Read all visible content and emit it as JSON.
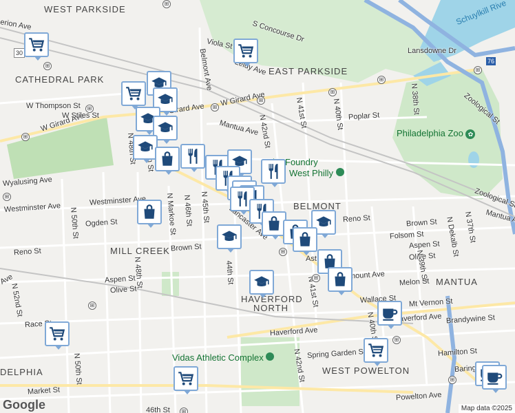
{
  "areas": [
    {
      "id": "west-parkside",
      "text": "WEST PARKSIDE"
    },
    {
      "id": "east-parkside",
      "text": "EAST PARKSIDE"
    },
    {
      "id": "cathedral-park",
      "text": "CATHEDRAL PARK"
    },
    {
      "id": "belmont",
      "text": "BELMONT"
    },
    {
      "id": "mill-creek",
      "text": "MILL CREEK"
    },
    {
      "id": "mantua",
      "text": "MANTUA"
    },
    {
      "id": "haverford-north-1",
      "text": "HAVERFORD"
    },
    {
      "id": "haverford-north-2",
      "text": "NORTH"
    },
    {
      "id": "west-powelton",
      "text": "WEST POWELTON"
    },
    {
      "id": "delphia",
      "text": "DELPHIA"
    }
  ],
  "pois": [
    {
      "id": "philadelphia-zoo",
      "text": "Philadelphia Zoo"
    },
    {
      "id": "foundry-1",
      "text": "The Foundry"
    },
    {
      "id": "foundry-2",
      "text": "West Philly"
    },
    {
      "id": "vidas",
      "text": "Vidas Athletic Complex"
    }
  ],
  "water": [
    {
      "id": "schuylkill",
      "text": "Schuylkill Rive"
    }
  ],
  "streets": [
    {
      "id": "s-concourse",
      "text": "S Concourse Dr"
    },
    {
      "id": "viola",
      "text": "Viola St"
    },
    {
      "id": "leidy",
      "text": "Leidy Ave"
    },
    {
      "id": "lansdowne",
      "text": "Lansdowne Dr"
    },
    {
      "id": "belmont-ave",
      "text": "Belmont Ave"
    },
    {
      "id": "w-girard-1",
      "text": "W Girard Ave"
    },
    {
      "id": "w-girard-2",
      "text": "W Girard Ave"
    },
    {
      "id": "girard-ave",
      "text": "Girard Ave"
    },
    {
      "id": "w-thompson",
      "text": "W Thompson St"
    },
    {
      "id": "w-stiles",
      "text": "W Stiles St"
    },
    {
      "id": "mantua-ave",
      "text": "Mantua Ave"
    },
    {
      "id": "mantua-ave-2",
      "text": "Mantua Ave"
    },
    {
      "id": "poplar",
      "text": "Poplar St"
    },
    {
      "id": "n-41st",
      "text": "N 41st St"
    },
    {
      "id": "n-40th",
      "text": "N 40th St"
    },
    {
      "id": "n-38th",
      "text": "N 38th St"
    },
    {
      "id": "n-42nd",
      "text": "N 42nd St"
    },
    {
      "id": "n-42nd-2",
      "text": "N 42nd St"
    },
    {
      "id": "zoological",
      "text": "Zoological St"
    },
    {
      "id": "zoological-2",
      "text": "Zoological St"
    },
    {
      "id": "wyalusing",
      "text": "Wyalusing Ave"
    },
    {
      "id": "westminster-1",
      "text": "Westminster Ave"
    },
    {
      "id": "westminster-2",
      "text": "Westminster Ave"
    },
    {
      "id": "n-48th",
      "text": "N 48th St"
    },
    {
      "id": "n-48th-2",
      "text": "N 48th St"
    },
    {
      "id": "n-47th",
      "text": "47th St"
    },
    {
      "id": "n-50th",
      "text": "N 50th St"
    },
    {
      "id": "ogden",
      "text": "Ogden St"
    },
    {
      "id": "n-markoe",
      "text": "N Markoe St"
    },
    {
      "id": "n-46th",
      "text": "N 46th St"
    },
    {
      "id": "n-45th",
      "text": "N 45th St"
    },
    {
      "id": "lancaster",
      "text": "Lancaster Ave"
    },
    {
      "id": "reno-w",
      "text": "Reno St"
    },
    {
      "id": "reno-e",
      "text": "Reno St"
    },
    {
      "id": "brown-w",
      "text": "Brown St"
    },
    {
      "id": "brown-e",
      "text": "Brown St"
    },
    {
      "id": "folsom",
      "text": "Folsom St"
    },
    {
      "id": "aspen-e",
      "text": "Aspen St"
    },
    {
      "id": "aspen-w",
      "text": "Aspen St"
    },
    {
      "id": "olive-e",
      "text": "Olive St"
    },
    {
      "id": "olive-w",
      "text": "Olive St"
    },
    {
      "id": "n-dekalb",
      "text": "N Dekalb St"
    },
    {
      "id": "n-37th",
      "text": "N 37th St"
    },
    {
      "id": "n-39th",
      "text": "N 39th St"
    },
    {
      "id": "n-44th",
      "text": "44th St"
    },
    {
      "id": "fairmount",
      "text": "mount Ave"
    },
    {
      "id": "melon",
      "text": "Melon St"
    },
    {
      "id": "n-41st-s",
      "text": "N 41st St"
    },
    {
      "id": "wallace",
      "text": "Wallace St"
    },
    {
      "id": "mt-vernon",
      "text": "Mt Vernon St"
    },
    {
      "id": "haverford-ave-e",
      "text": "Haverford Ave"
    },
    {
      "id": "haverford-ave-w",
      "text": "Haverford Ave"
    },
    {
      "id": "brandywine",
      "text": "Brandywine St"
    },
    {
      "id": "race",
      "text": "Race St"
    },
    {
      "id": "n-52nd",
      "text": "N 52nd St"
    },
    {
      "id": "spring-garden",
      "text": "Spring Garden St"
    },
    {
      "id": "hamilton",
      "text": "Hamilton St"
    },
    {
      "id": "baring",
      "text": "Baring"
    },
    {
      "id": "n-50th-s",
      "text": "N 50th St"
    },
    {
      "id": "market",
      "text": "Market St"
    },
    {
      "id": "powelton",
      "text": "Powelton Ave"
    },
    {
      "id": "s-46th",
      "text": "46th St"
    },
    {
      "id": "ave-w",
      "text": "Ave"
    },
    {
      "id": "n-40th-s",
      "text": "N 40th St"
    },
    {
      "id": "erion",
      "text": "erion Ave"
    },
    {
      "id": "rt-30",
      "text": "30"
    },
    {
      "id": "rt-76",
      "text": "76"
    },
    {
      "id": "ast",
      "text": "Ast"
    }
  ],
  "markers": [
    {
      "icon": "shopping-cart-icon"
    },
    {
      "icon": "shopping-cart-icon"
    },
    {
      "icon": "school-icon"
    },
    {
      "icon": "shopping-cart-icon"
    },
    {
      "icon": "school-icon"
    },
    {
      "icon": "school-icon"
    },
    {
      "icon": "school-icon"
    },
    {
      "icon": "school-icon"
    },
    {
      "icon": "shopping-bag-icon"
    },
    {
      "icon": "restaurant-icon"
    },
    {
      "icon": "restaurant-icon"
    },
    {
      "icon": "school-icon"
    },
    {
      "icon": "restaurant-icon"
    },
    {
      "icon": "restaurant-icon"
    },
    {
      "icon": "restaurant-icon"
    },
    {
      "icon": "shopping-bag-icon"
    },
    {
      "icon": "restaurant-icon"
    },
    {
      "icon": "restaurant-icon"
    },
    {
      "icon": "restaurant-icon"
    },
    {
      "icon": "shopping-bag-icon"
    },
    {
      "icon": "school-icon"
    },
    {
      "icon": "shopping-bag-icon"
    },
    {
      "icon": "shopping-bag-icon"
    },
    {
      "icon": "school-icon"
    },
    {
      "icon": "shopping-bag-icon"
    },
    {
      "icon": "shopping-bag-icon"
    },
    {
      "icon": "shopping-bag-icon"
    },
    {
      "icon": "school-icon"
    },
    {
      "icon": "coffee-icon"
    },
    {
      "icon": "shopping-cart-icon"
    },
    {
      "icon": "shopping-cart-icon"
    },
    {
      "icon": "shopping-cart-icon"
    },
    {
      "icon": "coffee-icon"
    },
    {
      "icon": "coffee-icon"
    }
  ],
  "colors": {
    "land": "#f2f1ee",
    "park": "#cfe8c9",
    "park_dark": "#b8dbb0",
    "water": "#9fd4e8",
    "highway": "#8fb3e0",
    "road": "#ffffff",
    "rail": "#bdbdbd",
    "marker_border": "#7fa8d6",
    "marker_icon": "#1f4a7a"
  },
  "branding": {
    "logo": "Google",
    "attribution": "Map data ©2025"
  }
}
